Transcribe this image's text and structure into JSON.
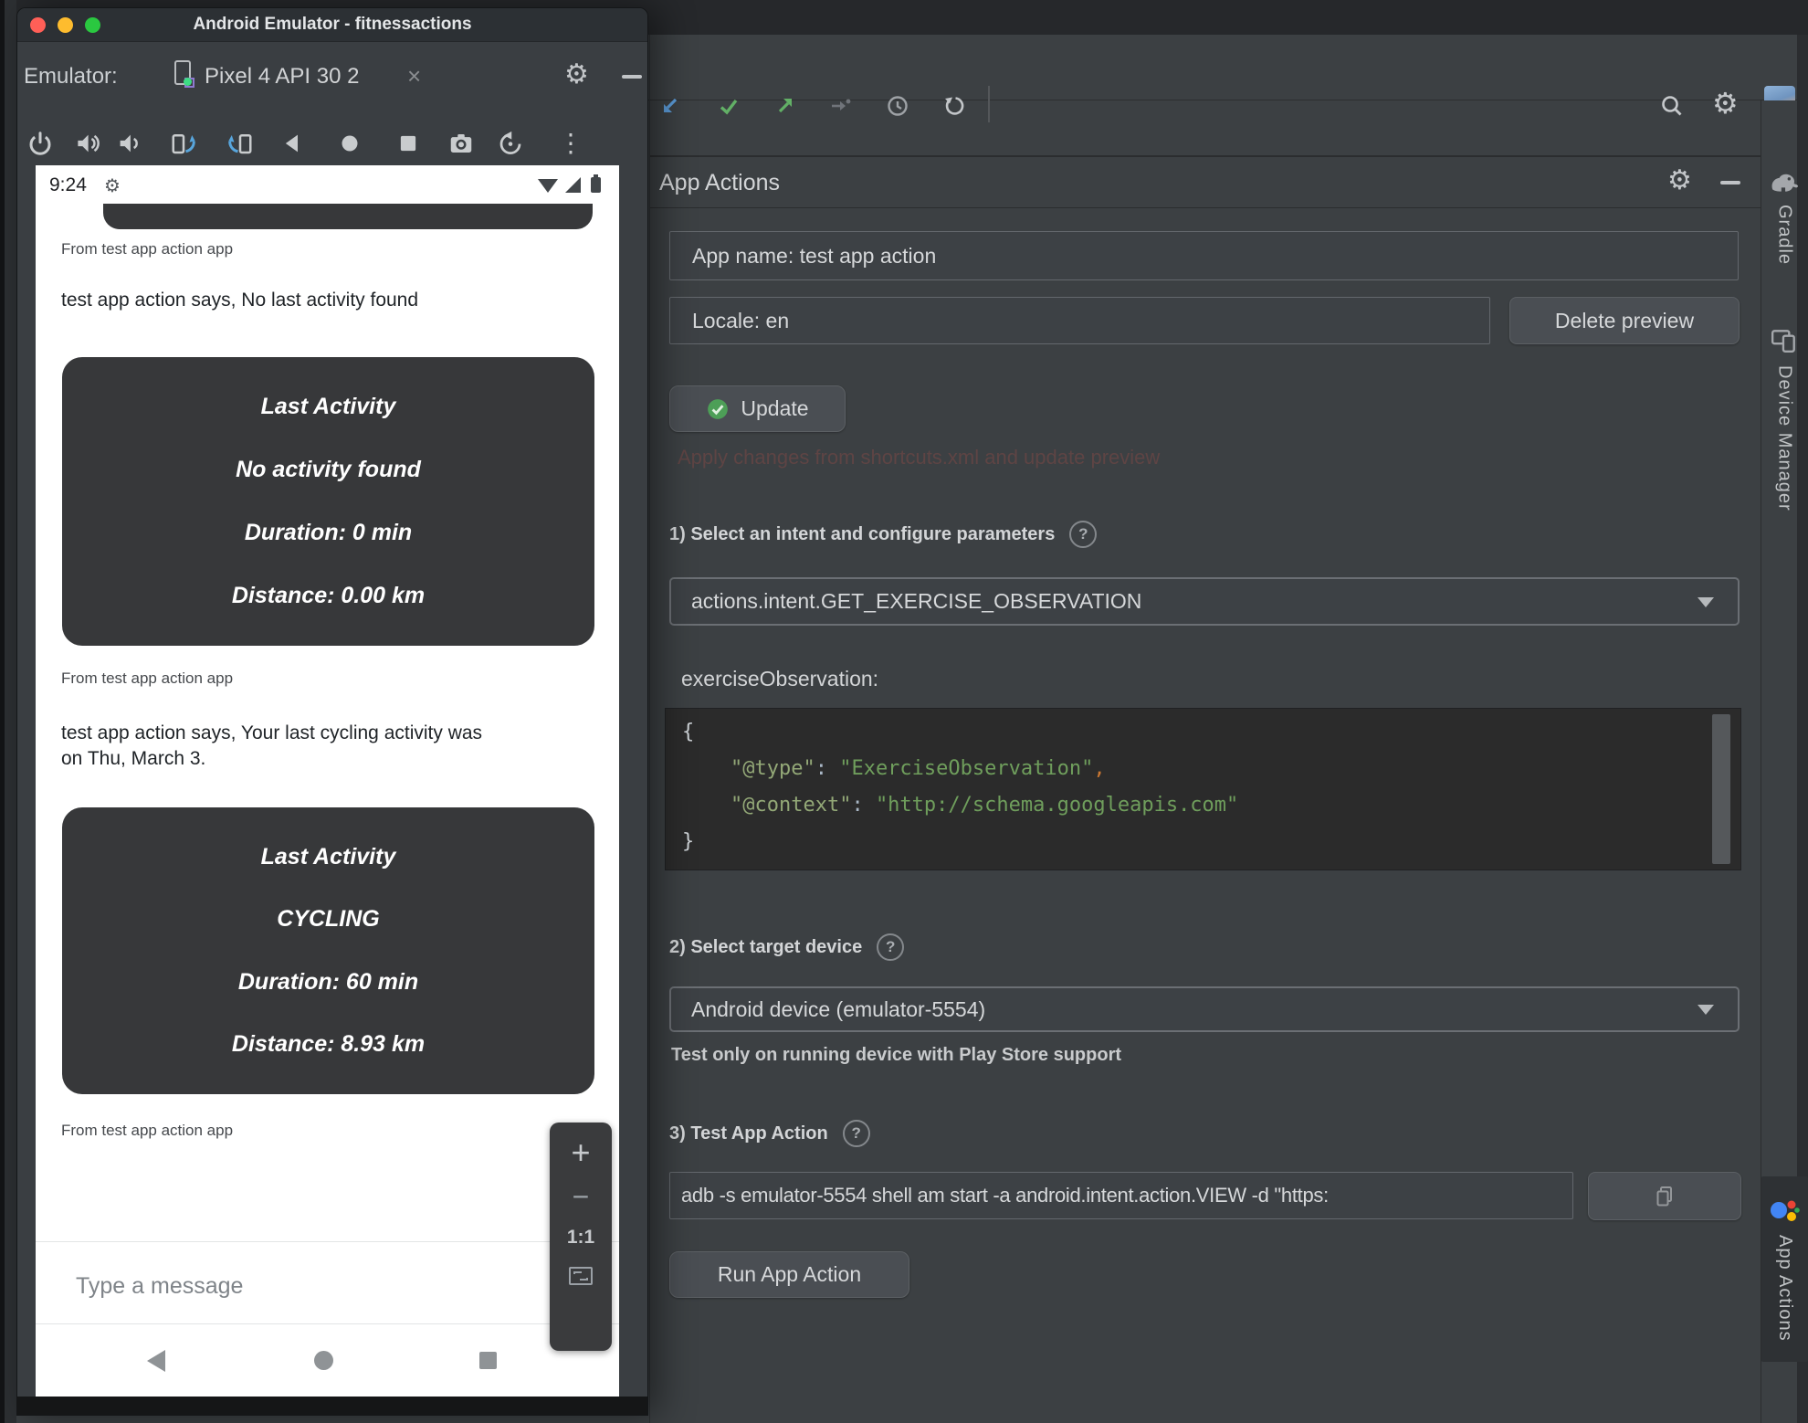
{
  "emulator_window": {
    "title": "Android Emulator - fitnessactions",
    "dock_label": "Emulator:",
    "tab_label": "Pixel 4 API 30 2",
    "close_glyph": "×",
    "gear_glyph": "⚙",
    "kebab_glyph": "⋮",
    "phone": {
      "status_time": "9:24",
      "sender_label": "From test app action app",
      "message1": "test app action says, No last activity found",
      "message2": "test app action says, Your last cycling activity was on Thu, March 3.",
      "card1": {
        "title": "Last Activity",
        "line1": "No activity found",
        "line2": "Duration: 0 min",
        "line3": "Distance: 0.00 km"
      },
      "card2": {
        "title": "Last Activity",
        "line1": "CYCLING",
        "line2": "Duration: 60 min",
        "line3": "Distance: 8.93 km"
      },
      "composer_placeholder": "Type a message",
      "zoom_in": "+",
      "zoom_out": "−",
      "actual_size": "1:1"
    }
  },
  "studio": {
    "panel_title": "App Actions",
    "gear_glyph": "⚙",
    "help_glyph": "?",
    "fields": {
      "app_name": "App name: test app action",
      "locale": "Locale: en"
    },
    "buttons": {
      "delete_preview": "Delete preview",
      "update": "Update",
      "run_app_action": "Run App Action"
    },
    "update_hint": "Apply changes from shortcuts.xml and update preview",
    "steps": {
      "step1": "1) Select an intent and configure parameters",
      "step2": "2) Select target device",
      "step3": "3) Test App Action"
    },
    "intent_value": "actions.intent.GET_EXERCISE_OBSERVATION",
    "param_label": "exerciseObservation:",
    "code_lines": [
      [
        {
          "t": "{",
          "c": "brace"
        }
      ],
      [
        {
          "t": "    ",
          "c": "punct"
        },
        {
          "t": "\"@type\"",
          "c": "key"
        },
        {
          "t": ": ",
          "c": "punct"
        },
        {
          "t": "\"ExerciseObservation\"",
          "c": "str"
        },
        {
          "t": ",",
          "c": "comma"
        }
      ],
      [
        {
          "t": "    ",
          "c": "punct"
        },
        {
          "t": "\"@context\"",
          "c": "key"
        },
        {
          "t": ": ",
          "c": "punct"
        },
        {
          "t": "\"http://schema.googleapis.com\"",
          "c": "str"
        }
      ],
      [
        {
          "t": "}",
          "c": "brace"
        }
      ]
    ],
    "device_value": "Android device (emulator-5554)",
    "device_note": "Test only on running device with Play Store support",
    "adb_command": "adb -s emulator-5554 shell am start -a android.intent.action.VIEW -d \"https:",
    "tabs": {
      "gradle": "Gradle",
      "device_manager": "Device Manager",
      "app_actions": "App Actions"
    },
    "colors": {
      "accent_blue": "#5585c2",
      "success_green": "#4d9f57",
      "code_string_green": "#6f9e5c",
      "code_comma_orange": "#cc7832"
    }
  }
}
